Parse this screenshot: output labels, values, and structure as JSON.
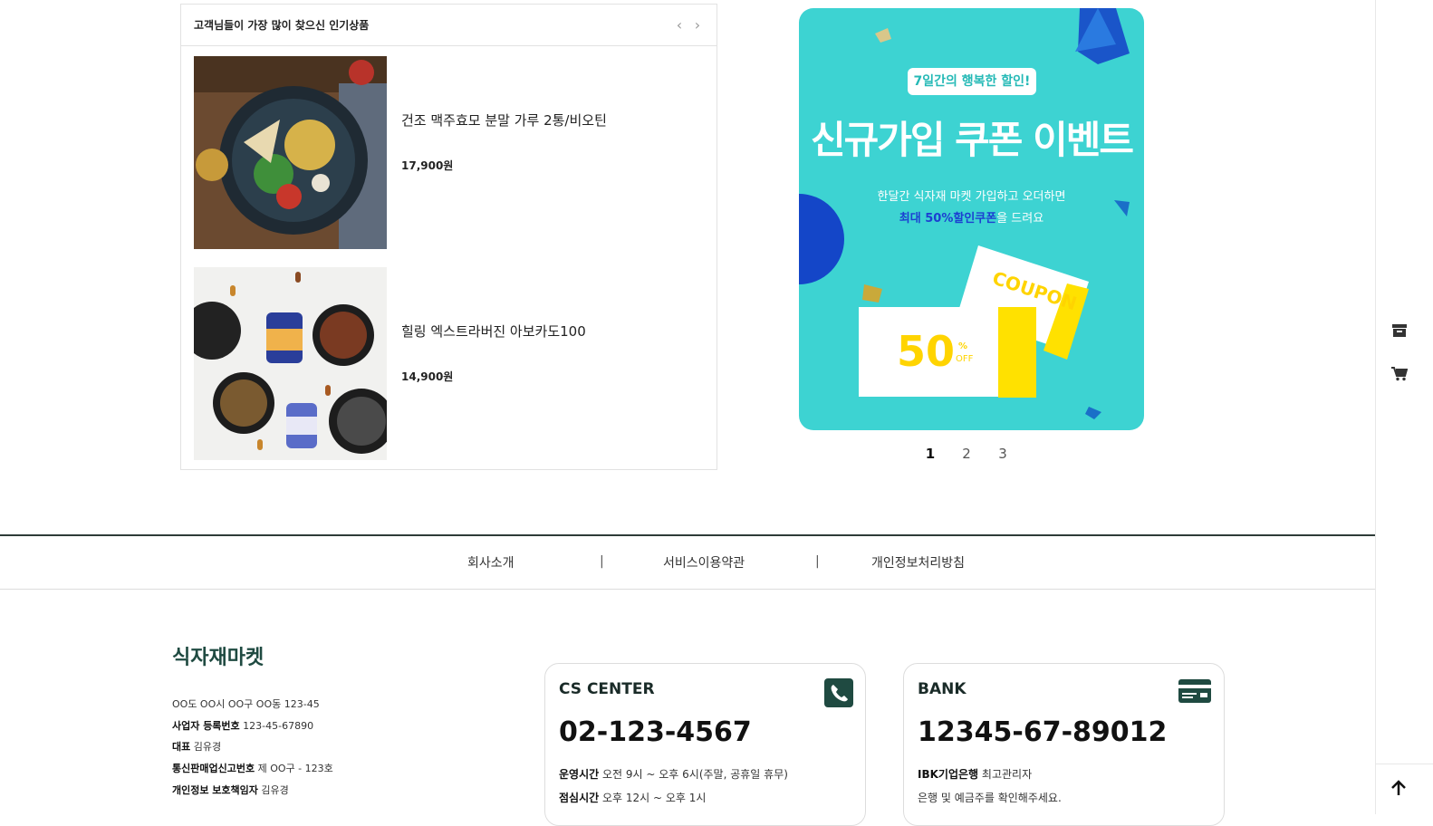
{
  "popular": {
    "title": "고객님들이 가장 많이 찾으신 인기상품",
    "products": [
      {
        "name": "건조 맥주효모 분말 가루 2통/비오틴",
        "price": "17,900원"
      },
      {
        "name": "힐링 엑스트라버진 아보카도100",
        "price": "14,900원"
      }
    ]
  },
  "banner": {
    "tag": "7일간의 행복한 할인!",
    "headline": "신규가입 쿠폰 이벤트",
    "desc_line1": "한달간 식자재 마켓 가입하고 오더하면",
    "desc_highlight": "최대 50%할인쿠폰",
    "desc_line2_rest": "을 드려요",
    "coupon_word": "COUPON",
    "coupon_value": "50",
    "coupon_pct": "%",
    "coupon_off": "OFF",
    "color_bg": "#3dd3d2",
    "color_ticket": "#ffe100"
  },
  "pager": {
    "pages": [
      "1",
      "2",
      "3"
    ],
    "active": "1"
  },
  "footer_nav": {
    "about": "회사소개",
    "terms": "서비스이용약관",
    "privacy": "개인정보처리방침",
    "separator": "|"
  },
  "company": {
    "name": "식자재마켓",
    "address": "OO도 OO시 OO구 OO동 123-45",
    "biz_label": "사업자 등록번호",
    "biz_value": "123-45-67890",
    "ceo_label": "대표",
    "ceo_value": "김유경",
    "mail_label": "통신판매업신고번호",
    "mail_value": "제 OO구 - 123호",
    "privacy_label": "개인정보 보호책임자",
    "privacy_value": "김유경"
  },
  "cs_center": {
    "title": "CS CENTER",
    "phone": "02-123-4567",
    "hours_label": "운영시간",
    "hours_value": "오전 9시 ~ 오후 6시(주말, 공휴일 휴무)",
    "lunch_label": "점심시간",
    "lunch_value": "오후 12시 ~ 오후 1시",
    "icon": "phone-icon"
  },
  "bank": {
    "title": "BANK",
    "account": "12345-67-89012",
    "bank_name": "IBK기업은행",
    "holder": "최고관리자",
    "note": "은행 및 예금주를 확인해주세요.",
    "icon": "card-icon"
  },
  "quickbar": {
    "icons": [
      "archive-icon",
      "cart-icon",
      "arrow-up-icon"
    ]
  },
  "colors": {
    "brand_dark": "#1f4a41",
    "accent_teal": "#3dd3d2"
  }
}
